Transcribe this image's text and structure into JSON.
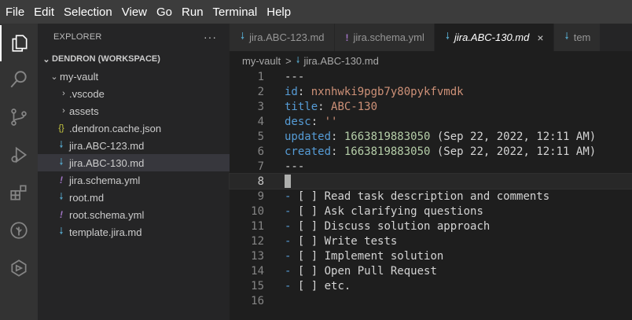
{
  "menu": [
    "File",
    "Edit",
    "Selection",
    "View",
    "Go",
    "Run",
    "Terminal",
    "Help"
  ],
  "explorer": {
    "title": "EXPLORER",
    "more": "···",
    "workspace": "DENDRON (WORKSPACE)",
    "folder": "my-vault",
    "items": [
      {
        "label": ".vscode",
        "type": "folder"
      },
      {
        "label": "assets",
        "type": "folder"
      },
      {
        "label": ".dendron.cache.json",
        "type": "json"
      },
      {
        "label": "jira.ABC-123.md",
        "type": "md"
      },
      {
        "label": "jira.ABC-130.md",
        "type": "md",
        "selected": true
      },
      {
        "label": "jira.schema.yml",
        "type": "yml"
      },
      {
        "label": "root.md",
        "type": "md"
      },
      {
        "label": "root.schema.yml",
        "type": "yml"
      },
      {
        "label": "template.jira.md",
        "type": "md"
      }
    ]
  },
  "tabs": [
    {
      "label": "jira.ABC-123.md",
      "type": "md"
    },
    {
      "label": "jira.schema.yml",
      "type": "yml"
    },
    {
      "label": "jira.ABC-130.md",
      "type": "md",
      "active": true,
      "close": "×"
    },
    {
      "label": "tem",
      "type": "md"
    }
  ],
  "breadcrumb": {
    "folder": "my-vault",
    "separator": ">",
    "file": "jira.ABC-130.md"
  },
  "editor": {
    "current_line": 8,
    "lines": [
      {
        "n": "1",
        "tokens": [
          {
            "t": "---",
            "c": "d"
          }
        ]
      },
      {
        "n": "2",
        "tokens": [
          {
            "t": "id",
            "c": "k"
          },
          {
            "t": ": ",
            "c": "p"
          },
          {
            "t": "nxnhwki9pgb7y80pykfvmdk",
            "c": "s"
          }
        ]
      },
      {
        "n": "3",
        "tokens": [
          {
            "t": "title",
            "c": "k"
          },
          {
            "t": ": ",
            "c": "p"
          },
          {
            "t": "ABC-130",
            "c": "s"
          }
        ]
      },
      {
        "n": "4",
        "tokens": [
          {
            "t": "desc",
            "c": "k"
          },
          {
            "t": ": ",
            "c": "p"
          },
          {
            "t": "''",
            "c": "s"
          }
        ]
      },
      {
        "n": "5",
        "tokens": [
          {
            "t": "updated",
            "c": "k"
          },
          {
            "t": ": ",
            "c": "p"
          },
          {
            "t": "1663819883050",
            "c": "n"
          },
          {
            "t": " (Sep 22, 2022, 12:11 AM)",
            "c": "p"
          }
        ]
      },
      {
        "n": "6",
        "tokens": [
          {
            "t": "created",
            "c": "k"
          },
          {
            "t": ": ",
            "c": "p"
          },
          {
            "t": "1663819883050",
            "c": "n"
          },
          {
            "t": " (Sep 22, 2022, 12:11 AM)",
            "c": "p"
          }
        ]
      },
      {
        "n": "7",
        "tokens": [
          {
            "t": "---",
            "c": "d"
          }
        ]
      },
      {
        "n": "8",
        "tokens": [],
        "cursor": true
      },
      {
        "n": "9",
        "tokens": [
          {
            "t": "-",
            "c": "lb"
          },
          {
            "t": " [ ] Read task description and comments",
            "c": "p"
          }
        ]
      },
      {
        "n": "10",
        "tokens": [
          {
            "t": "-",
            "c": "lb"
          },
          {
            "t": " [ ] Ask clarifying questions",
            "c": "p"
          }
        ]
      },
      {
        "n": "11",
        "tokens": [
          {
            "t": "-",
            "c": "lb"
          },
          {
            "t": " [ ] Discuss solution approach",
            "c": "p"
          }
        ]
      },
      {
        "n": "12",
        "tokens": [
          {
            "t": "-",
            "c": "lb"
          },
          {
            "t": " [ ] Write tests",
            "c": "p"
          }
        ]
      },
      {
        "n": "13",
        "tokens": [
          {
            "t": "-",
            "c": "lb"
          },
          {
            "t": " [ ] Implement solution",
            "c": "p"
          }
        ]
      },
      {
        "n": "14",
        "tokens": [
          {
            "t": "-",
            "c": "lb"
          },
          {
            "t": " [ ] Open Pull Request",
            "c": "p"
          }
        ]
      },
      {
        "n": "15",
        "tokens": [
          {
            "t": "-",
            "c": "lb"
          },
          {
            "t": " [ ] etc.",
            "c": "p"
          }
        ]
      },
      {
        "n": "16",
        "tokens": []
      }
    ]
  },
  "activity": [
    "explorer-icon",
    "search-icon",
    "source-control-icon",
    "run-debug-icon",
    "extensions-icon",
    "dendron-icon",
    "graph-icon"
  ],
  "colors": {
    "key": "#569cd6",
    "string": "#ce9178",
    "number": "#b5cea8",
    "md_icon": "#519aba",
    "yml_icon": "#a074c4",
    "json_icon": "#cbcb41"
  }
}
